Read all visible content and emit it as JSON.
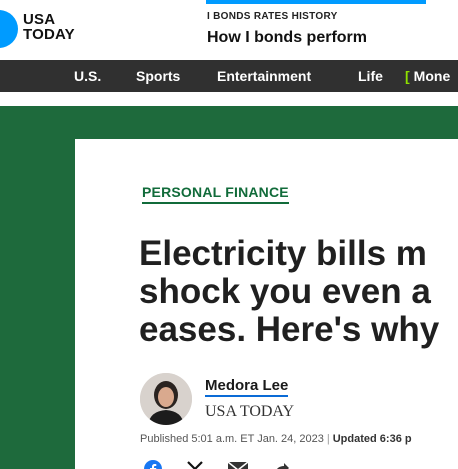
{
  "header": {
    "logo_line1": "USA",
    "logo_line2": "TODAY",
    "promo_kicker": "I BONDS RATES HISTORY",
    "promo_title": "How I bonds perform"
  },
  "nav": {
    "items": [
      "U.S.",
      "Sports",
      "Entertainment",
      "Life",
      "Mone"
    ]
  },
  "article": {
    "section": "PERSONAL FINANCE",
    "headline_lines": [
      "Electricity bills m",
      "shock you even a",
      "eases. Here's why"
    ],
    "author_name": "Medora Lee",
    "author_org": "USA TODAY",
    "published": "Published 5:01 a.m. ET Jan. 24, 2023",
    "separator": "|",
    "updated": "Updated 6:36 p"
  },
  "colors": {
    "brand_blue": "#009bff",
    "nav_bg": "#303030",
    "page_bg": "#1e6a3c",
    "section_green": "#116b3a",
    "nav_accent": "#8ee000"
  },
  "icons": [
    "facebook-icon",
    "x-twitter-icon",
    "email-icon",
    "share-icon"
  ]
}
